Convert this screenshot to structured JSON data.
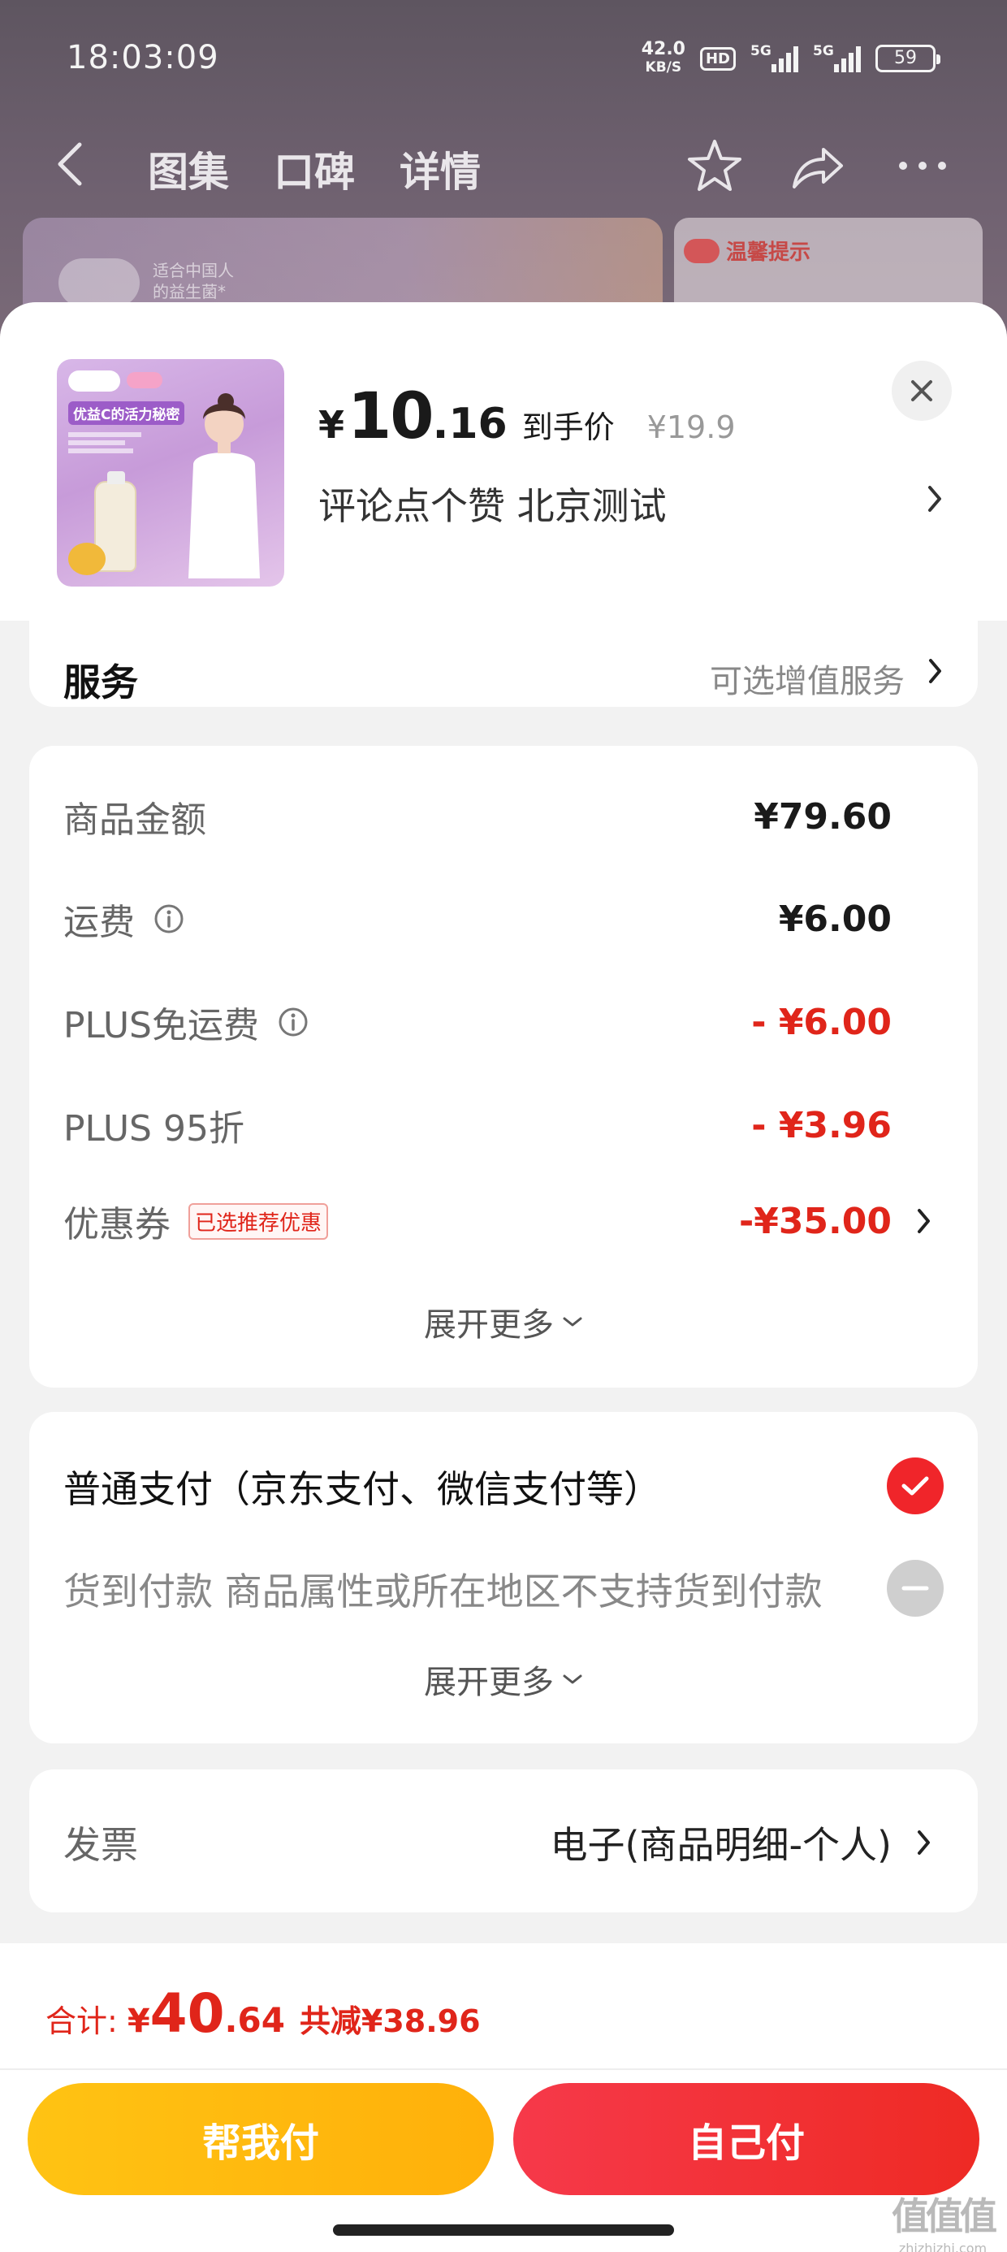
{
  "status_bar": {
    "time": "18:03:09",
    "net_speed_value": "42.0",
    "net_speed_unit": "KB/S",
    "hd": "HD",
    "signal1": "5G",
    "signal2": "5G",
    "battery": "59"
  },
  "nav": {
    "tabs": [
      "图集",
      "口碑",
      "详情"
    ]
  },
  "background": {
    "banner_text_1": "适合中国人",
    "banner_text_2": "的益生菌*",
    "tip": "温馨提示"
  },
  "product": {
    "thumb_title": "优益C的活力秘密",
    "price_symbol": "¥",
    "price_int": "10",
    "price_dec": ".16",
    "price_tag": "到手价",
    "original_price": "¥19.9",
    "subtitle": "评论点个赞  北京测试"
  },
  "service": {
    "title": "服务",
    "hint": "可选增值服务"
  },
  "amounts": {
    "rows": [
      {
        "label": "商品金额",
        "value": "¥79.60"
      },
      {
        "label": "运费",
        "value": "¥6.00"
      },
      {
        "label": "PLUS免运费",
        "value": "- ¥6.00"
      },
      {
        "label": "PLUS 95折",
        "value": "- ¥3.96"
      },
      {
        "label": "优惠券",
        "value": "-¥35.00"
      }
    ],
    "coupon_badge": "已选推荐优惠",
    "expand": "展开更多"
  },
  "payment": {
    "normal": "普通支付（京东支付、微信支付等）",
    "cod": "货到付款 商品属性或所在地区不支持货到付款",
    "expand": "展开更多"
  },
  "invoice": {
    "label": "发票",
    "value": "电子(商品明细-个人)"
  },
  "footer": {
    "total_label": "合计:",
    "total_symbol": "¥",
    "total_int": "40",
    "total_dec": ".64",
    "total_saved": "共减¥38.96",
    "help_pay": "帮我付",
    "self_pay": "自己付"
  },
  "watermark": {
    "main": "值值值",
    "sub": "zhizhizhi.com"
  },
  "colors": {
    "accent_red": "#e0251a",
    "check_red": "#f0252a",
    "help_yellow": "#ffc313"
  }
}
